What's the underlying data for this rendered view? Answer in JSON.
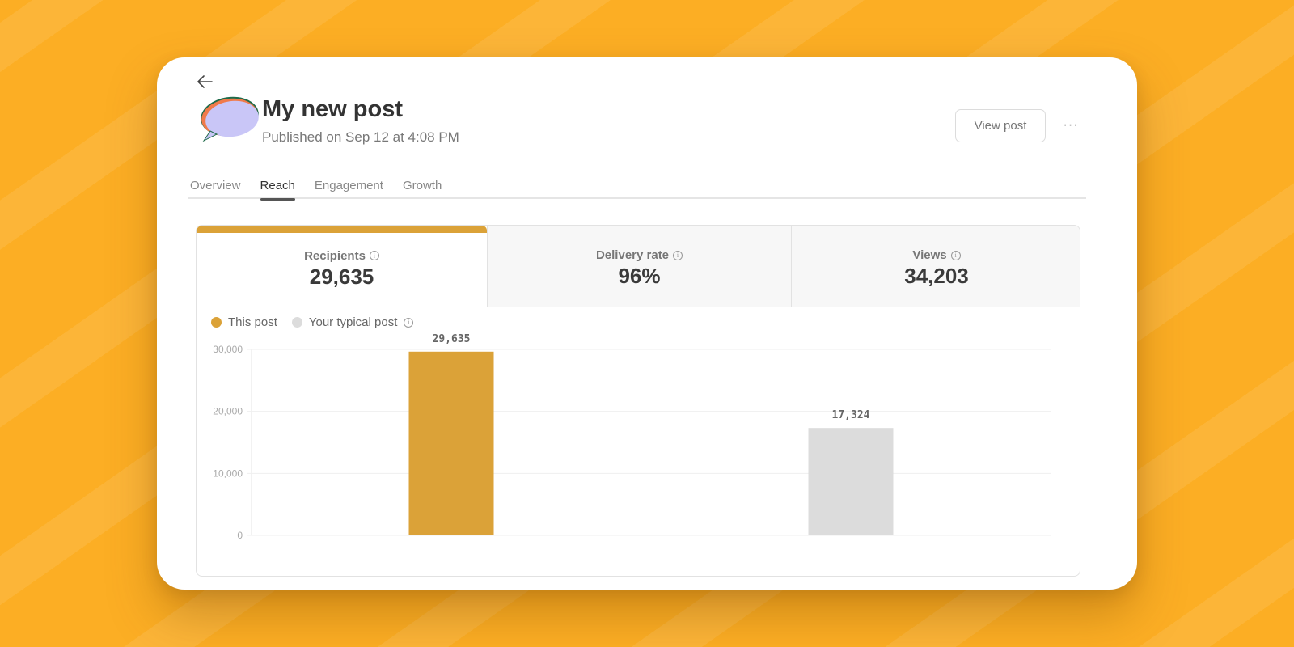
{
  "header": {
    "back_icon": "arrow-left-icon",
    "logo_icon": "speech-bubble-logo-icon",
    "title": "My new post",
    "subtitle": "Published on Sep 12 at 4:08 PM",
    "view_post_label": "View post",
    "more_label": "···"
  },
  "tabs": [
    {
      "label": "Overview",
      "active": false
    },
    {
      "label": "Reach",
      "active": true
    },
    {
      "label": "Engagement",
      "active": false
    },
    {
      "label": "Growth",
      "active": false
    }
  ],
  "stats": [
    {
      "label": "Recipients",
      "value": "29,635",
      "active": true
    },
    {
      "label": "Delivery rate",
      "value": "96%",
      "active": false
    },
    {
      "label": "Views",
      "value": "34,203",
      "active": false
    }
  ],
  "legend": {
    "this_post": "This post",
    "typical_post": "Your typical post",
    "info_glyph": "i"
  },
  "colors": {
    "accent": "#DBA238",
    "typical": "#DCDCDC",
    "background": "#FCAE24"
  },
  "chart_data": {
    "type": "bar",
    "categories": [
      "This post",
      "Your typical post"
    ],
    "values": [
      29635,
      17324
    ],
    "value_labels": [
      "29,635",
      "17,324"
    ],
    "colors": [
      "#DBA238",
      "#DCDCDC"
    ],
    "title": "",
    "xlabel": "",
    "ylabel": "",
    "ylim": [
      0,
      30000
    ],
    "yticks": [
      0,
      10000,
      20000,
      30000
    ],
    "ytick_labels": [
      "0",
      "10,000",
      "20,000",
      "30,000"
    ],
    "grid": true,
    "legend": "top-left"
  }
}
